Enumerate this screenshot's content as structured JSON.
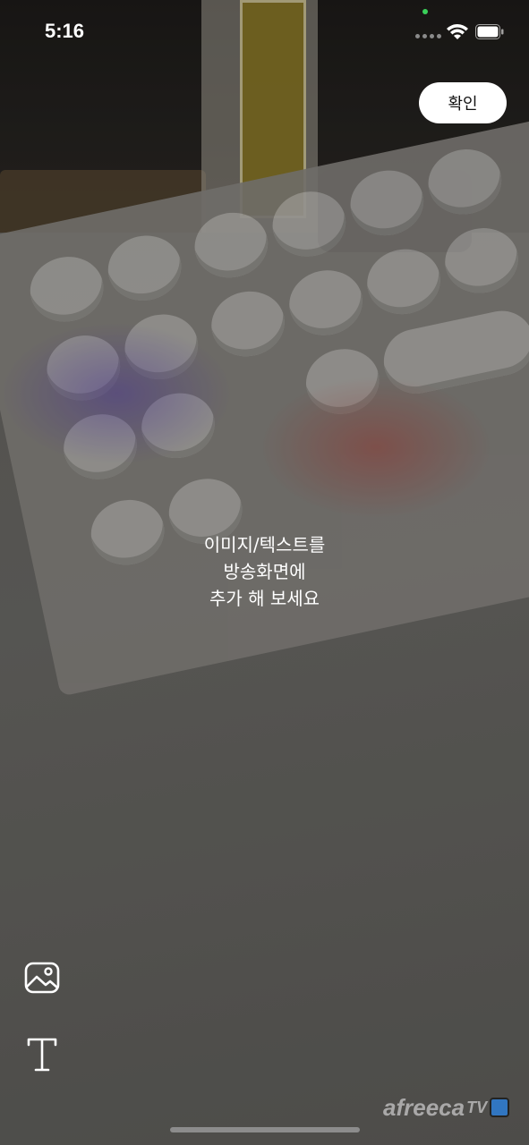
{
  "status_bar": {
    "time": "5:16",
    "camera_indicator_color": "#3ad05a",
    "icons": [
      "signal-icon",
      "wifi-icon",
      "battery-icon"
    ]
  },
  "header": {
    "confirm_label": "확인"
  },
  "overlay": {
    "line1": "이미지/텍스트를",
    "line2": "방송화면에",
    "line3": "추가 해 보세요"
  },
  "toolbar": {
    "items": [
      {
        "icon": "image-icon"
      },
      {
        "icon": "text-icon"
      }
    ]
  },
  "watermark": {
    "brand": "afreeca",
    "brand_suffix": "TV"
  },
  "colors": {
    "confirm_bg": "#ffffff",
    "text": "#ffffff"
  }
}
